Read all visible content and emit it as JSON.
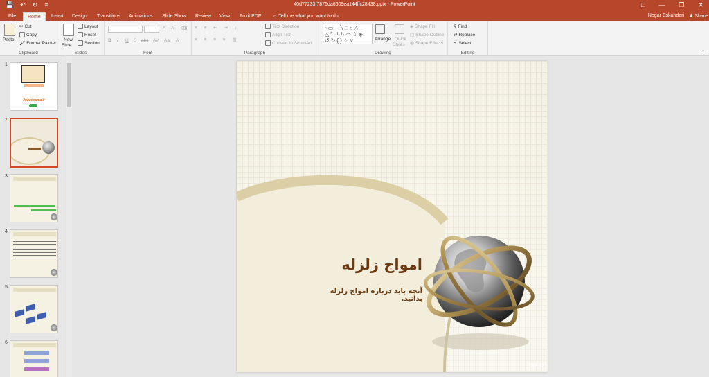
{
  "titlebar": {
    "doc_title": "40d77233f7876da6609ea144ffc28438.pptx - PowerPoint",
    "save_icon": "save-icon",
    "undo_icon": "undo-icon",
    "redo_icon": "redo-icon"
  },
  "tabs": [
    "File",
    "Home",
    "Insert",
    "Design",
    "Transitions",
    "Animations",
    "Slide Show",
    "Review",
    "View",
    "Foxit PDF"
  ],
  "tell_me": "Tell me what you want to do...",
  "user": "Negar Eskandari",
  "share": "Share",
  "ribbon": {
    "clipboard": {
      "paste": "Paste",
      "cut": "Cut",
      "copy": "Copy",
      "format_painter": "Format Painter",
      "label": "Clipboard"
    },
    "slides": {
      "new_slide": "New",
      "new_slide2": "Slide",
      "layout": "Layout",
      "reset": "Reset",
      "section": "Section",
      "label": "Slides"
    },
    "font": {
      "label": "Font",
      "bold": "B",
      "italic": "I",
      "underline": "U",
      "strike": "S",
      "abc": "abc",
      "spacing": "AV",
      "case": "Aa"
    },
    "paragraph": {
      "label": "Paragraph",
      "text_direction": "Text Direction",
      "align_text": "Align Text",
      "convert_smartart": "Convert to SmartArt"
    },
    "drawing": {
      "label": "Drawing",
      "arrange": "Arrange",
      "quick_styles": "Quick",
      "quick_styles2": "Styles",
      "shape_fill": "Shape Fill",
      "shape_outline": "Shape Outline",
      "shape_effects": "Shape Effects"
    },
    "editing": {
      "label": "Editing",
      "find": "Find",
      "replace": "Replace",
      "select": "Select"
    }
  },
  "thumbnails": [
    {
      "num": "1",
      "url_text": "Jozvebama.ir"
    },
    {
      "num": "2"
    },
    {
      "num": "3"
    },
    {
      "num": "4"
    },
    {
      "num": "5"
    },
    {
      "num": "6"
    }
  ],
  "slide": {
    "title": "امواج زلزله",
    "subtitle": "آنچه باید درباره امواج زلزله بدانید.",
    "footer": "fppt.com"
  },
  "colors": {
    "accent": "#b7472a",
    "slide_text": "#6b3a10",
    "selected_thumb": "#d24726"
  }
}
